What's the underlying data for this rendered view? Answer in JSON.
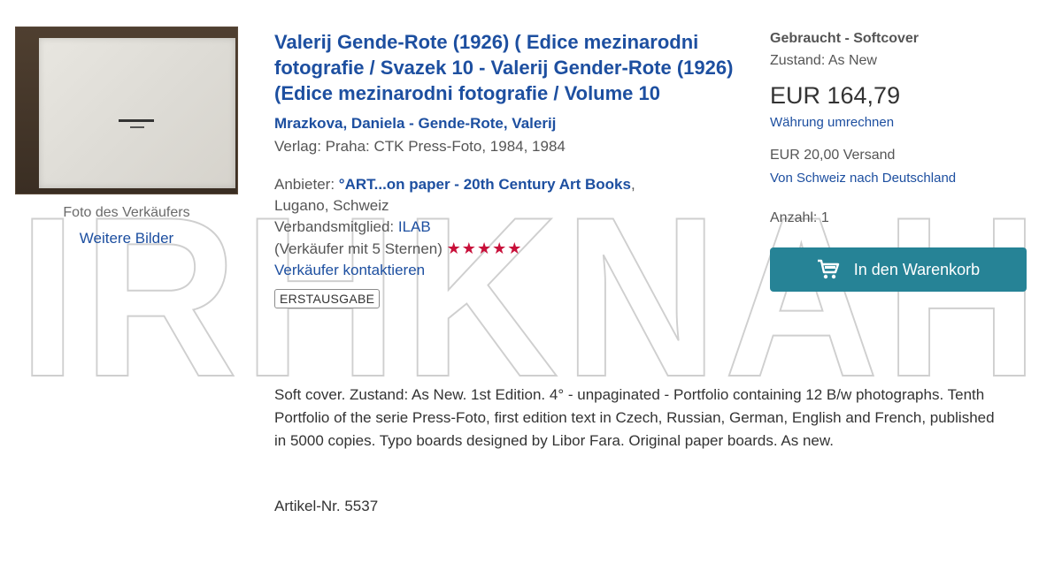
{
  "watermark": {
    "text": "IRHKNAH"
  },
  "photo": {
    "caption": "Foto des Verkäufers",
    "more_link": "Weitere Bilder"
  },
  "listing": {
    "title": "Valerij Gende-Rote (1926) ( Edice mezinarodni fotografie / Svazek 10 - Valerij Gender-Rote (1926) (Edice mezinarodni fotografie / Volume 10",
    "author": "Mrazkova, Daniela - Gende-Rote, Valerij",
    "publisher_label": "Verlag:",
    "publisher": "Praha: CTK Press-Foto, 1984, 1984",
    "seller_label": "Anbieter:",
    "seller_name": "°ART...on paper - 20th Century Art Books",
    "seller_location": "Lugano, Schweiz",
    "membership_label": "Verbandsmitglied:",
    "membership": "ILAB",
    "rating_text": "(Verkäufer mit 5 Sternen)",
    "rating_stars": 5,
    "contact_link": "Verkäufer kontaktieren",
    "badge": "ERSTAUSGABE",
    "description": "Soft cover. Zustand: As New. 1st Edition. 4° - unpaginated - Portfolio containing 12 B/w photographs. Tenth Portfolio of the serie Press-Foto, first edition text in Czech, Russian, German, English and French, published in 5000 copies. Typo boards designed by Libor Fara. Original paper boards. As new.",
    "article_number": "Artikel-Nr. 5537"
  },
  "buy_box": {
    "condition_title": "Gebraucht - Softcover",
    "condition": "Zustand: As New",
    "price": "EUR 164,79",
    "convert_link": "Währung umrechnen",
    "shipping": "EUR 20,00 Versand",
    "shipping_link": "Von Schweiz nach Deutschland",
    "quantity": "Anzahl: 1",
    "cart_button": "In den Warenkorb",
    "button_color": "#268396"
  },
  "colors": {
    "link": "#1d4fa0",
    "star": "#c8103a"
  }
}
